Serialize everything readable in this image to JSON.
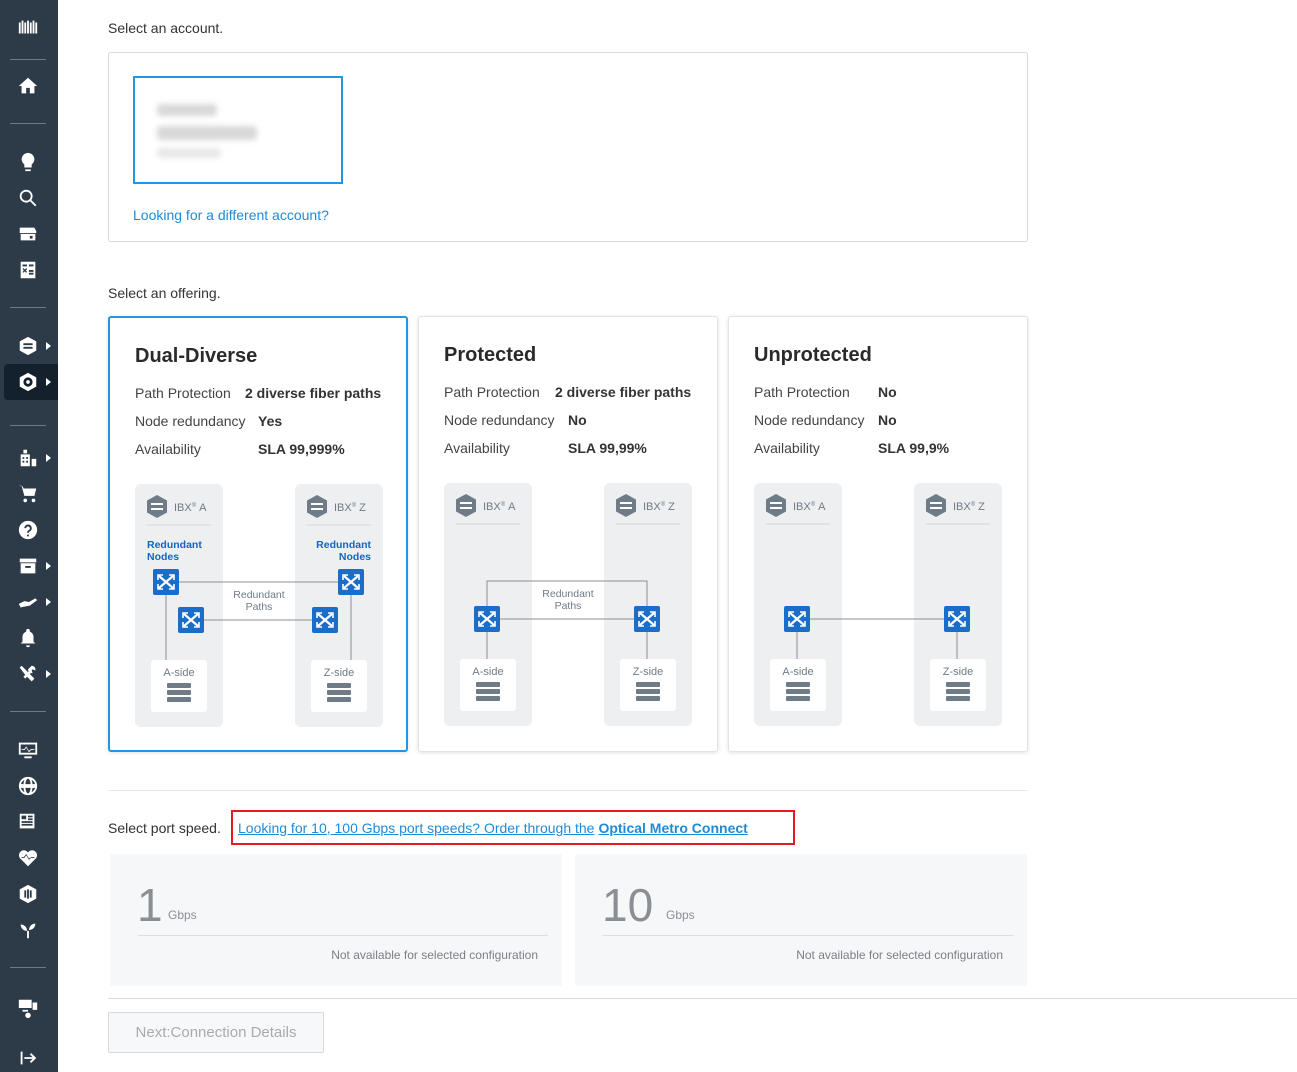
{
  "sidebar": {
    "icons": [
      "equinix-logo-icon",
      "home-icon",
      "lightbulb-icon",
      "search-icon",
      "storefront-icon",
      "calculator-icon",
      "ibx-hex-icon",
      "fabric-gear-icon",
      "building-orders-icon",
      "cart-icon",
      "help-icon",
      "archive-icon",
      "handshake-icon",
      "bell-icon",
      "tools-icon",
      "monitor-icon",
      "globe-icon",
      "news-icon",
      "health-icon",
      "metal-icon",
      "sprout-icon",
      "devices-icon",
      "logout-icon"
    ]
  },
  "account": {
    "label": "Select an account.",
    "different_link": "Looking for a different account?"
  },
  "offering": {
    "label": "Select an offering.",
    "keys": {
      "path": "Path Protection",
      "node": "Node redundancy",
      "avail": "Availability"
    },
    "cards": [
      {
        "title": "Dual-Diverse",
        "path": "2 diverse fiber paths",
        "node": "Yes",
        "avail": "SLA 99,999%"
      },
      {
        "title": "Protected",
        "path": "2 diverse fiber paths",
        "node": "No",
        "avail": "SLA 99,99%"
      },
      {
        "title": "Unprotected",
        "path": "No",
        "node": "No",
        "avail": "SLA 99,9%"
      }
    ],
    "diagram": {
      "ibx_a": "IBX",
      "ibx_a_suffix": "A",
      "ibx_z": "IBX",
      "ibx_z_suffix": "Z",
      "reg": "®",
      "redundant_nodes_1": "Redundant",
      "redundant_nodes_2": "Nodes",
      "redundant_paths_1": "Redundant",
      "redundant_paths_2": "Paths",
      "a_side": "A-side",
      "z_side": "Z-side"
    }
  },
  "port": {
    "label": "Select port speed.",
    "callout": "Looking for 10, 100 Gbps port speeds? Order through the",
    "callout_link": "Optical Metro Connect",
    "options": [
      {
        "value": "1",
        "unit": "Gbps",
        "note": "Not available for selected configuration"
      },
      {
        "value": "10",
        "unit": "Gbps",
        "note": "Not available for selected configuration"
      }
    ]
  },
  "actions": {
    "next_label": "Next:Connection Details"
  },
  "colors": {
    "accent": "#1e97e6",
    "link": "#1e8bd8",
    "callout_border": "#e01b22",
    "node_blue": "#1565c0",
    "sidebar": "#2d3a47"
  }
}
